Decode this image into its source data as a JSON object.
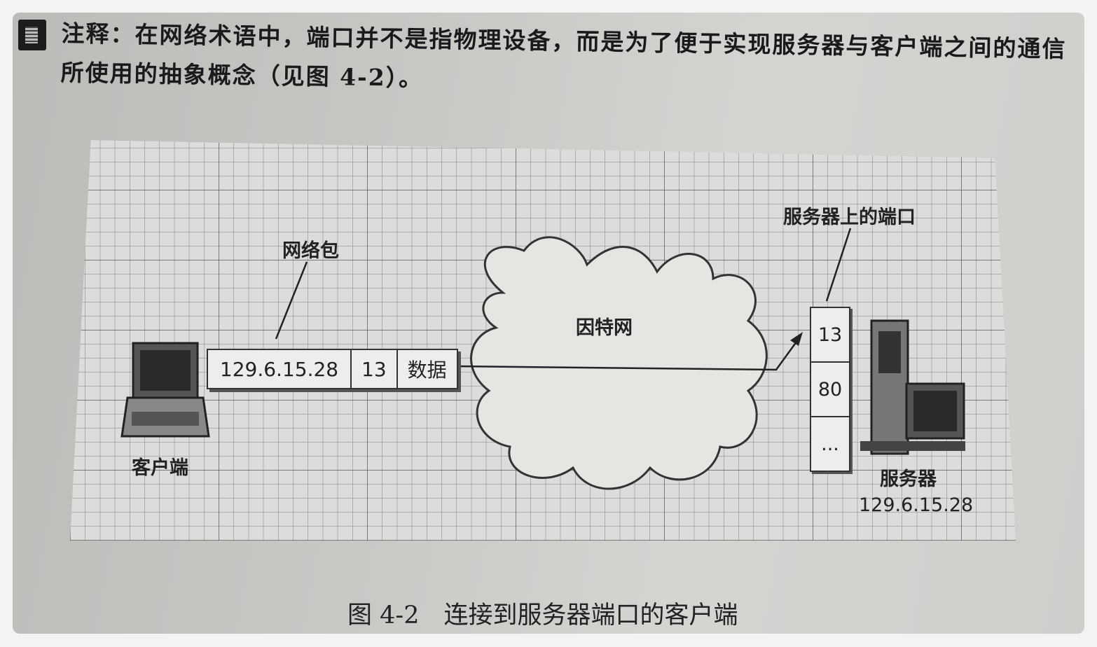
{
  "note": {
    "icon": "note-icon",
    "text": "注释：在网络术语中，端口并不是指物理设备，而是为了便于实现服务器与客户端之间的通信所使用的抽象概念（见图 4-2）。"
  },
  "diagram": {
    "packet_label": "网络包",
    "packet": {
      "ip": "129.6.15.28",
      "port": "13",
      "data": "数据"
    },
    "client_label": "客户端",
    "internet_label": "因特网",
    "server_port_label": "服务器上的端口",
    "ports": [
      "13",
      "80",
      "..."
    ],
    "server_label": "服务器",
    "server_ip": "129.6.15.28"
  },
  "caption": "图 4-2　连接到服务器端口的客户端"
}
